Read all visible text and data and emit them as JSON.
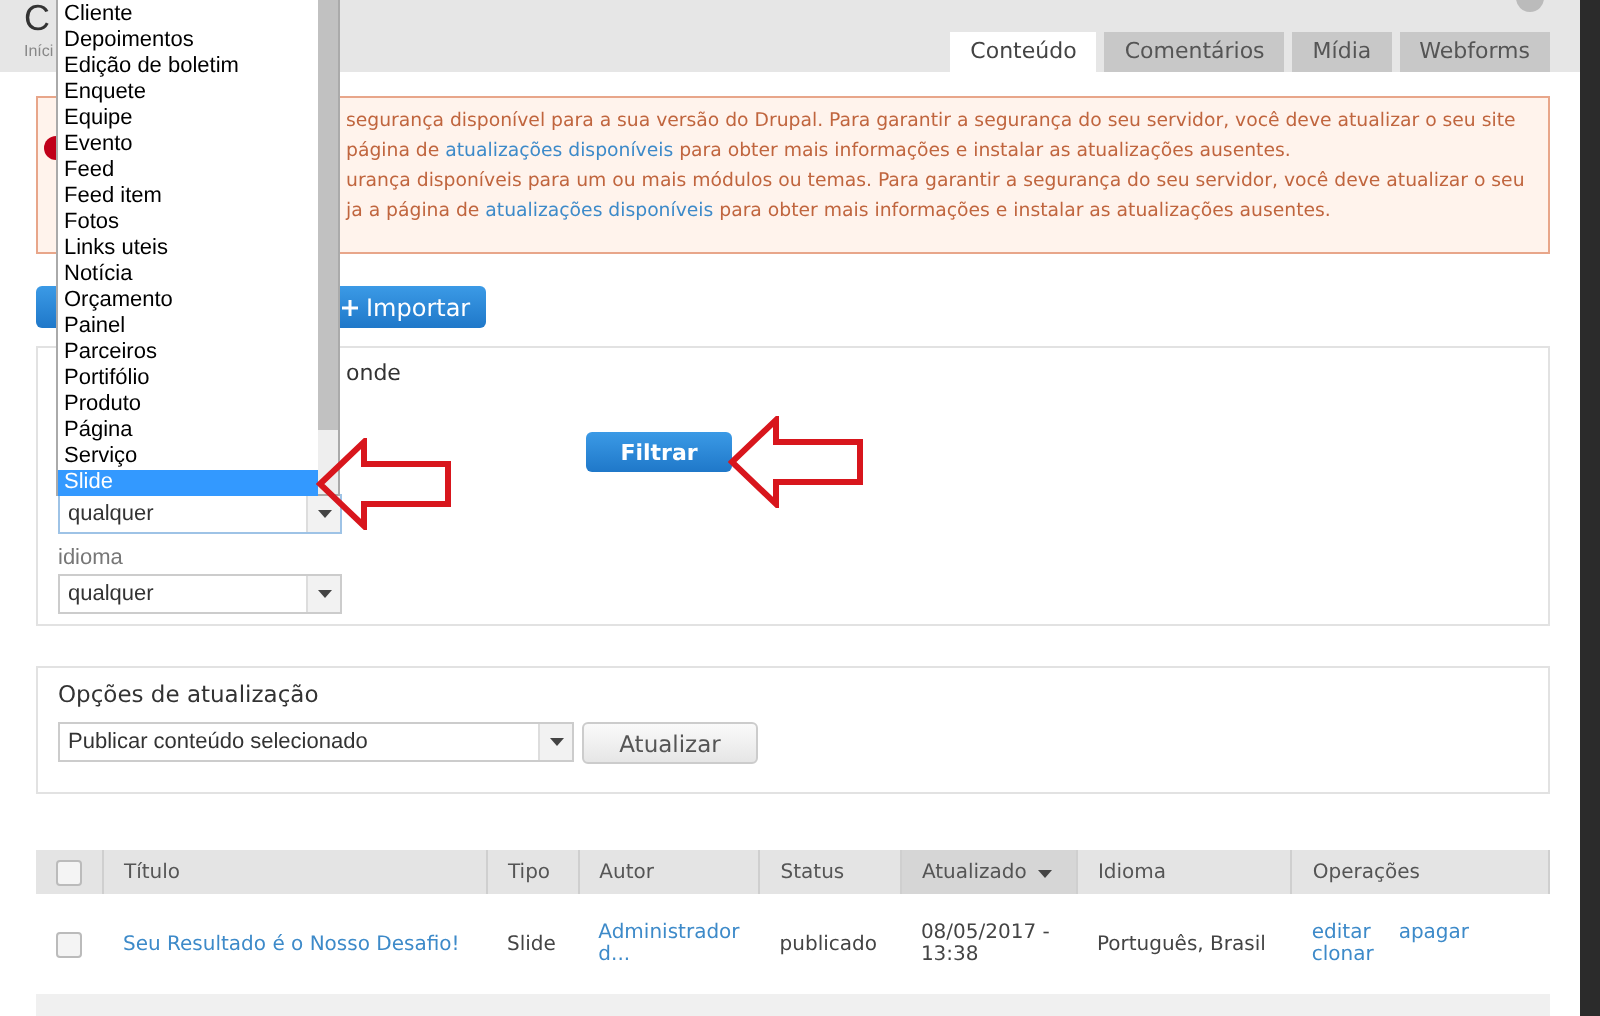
{
  "page": {
    "title": "C",
    "breadcrumb": "Iníci"
  },
  "tabs": [
    {
      "label": "Conteúdo",
      "selected": true
    },
    {
      "label": "Comentários",
      "selected": false
    },
    {
      "label": "Mídia",
      "selected": false
    },
    {
      "label": "Webforms",
      "selected": false
    }
  ],
  "warning": {
    "lines": [
      {
        "text": "segurança disponível para a sua versão do Drupal. Para garantir a segurança do seu servidor, você deve atualizar o seu site"
      },
      {
        "text": "página de ",
        "link": "atualizações disponíveis",
        "after": " para obter mais informações e instalar as atualizações ausentes."
      },
      {
        "text": "urança disponíveis para um ou mais módulos ou temas. Para garantir a segurança do seu servidor, você deve atualizar o seu"
      },
      {
        "text": "ja a página de ",
        "link": "atualizações disponíveis",
        "after": " para obter mais informações e instalar as atualizações ausentes."
      }
    ]
  },
  "actions": {
    "import_button": "Importar"
  },
  "filter": {
    "legend": "onde",
    "type_select": {
      "value": "qualquer",
      "expanded": true,
      "options": [
        {
          "label": "Cliente",
          "selected": false
        },
        {
          "label": "Depoimentos",
          "selected": false
        },
        {
          "label": "Edição de boletim",
          "selected": false
        },
        {
          "label": "Enquete",
          "selected": false
        },
        {
          "label": "Equipe",
          "selected": false
        },
        {
          "label": "Evento",
          "selected": false
        },
        {
          "label": "Feed",
          "selected": false
        },
        {
          "label": "Feed item",
          "selected": false
        },
        {
          "label": "Fotos",
          "selected": false
        },
        {
          "label": "Links uteis",
          "selected": false
        },
        {
          "label": "Notícia",
          "selected": false
        },
        {
          "label": "Orçamento",
          "selected": false
        },
        {
          "label": "Painel",
          "selected": false
        },
        {
          "label": "Parceiros",
          "selected": false
        },
        {
          "label": "Portifólio",
          "selected": false
        },
        {
          "label": "Produto",
          "selected": false
        },
        {
          "label": "Página",
          "selected": false
        },
        {
          "label": "Serviço",
          "selected": false
        },
        {
          "label": "Slide",
          "selected": true
        }
      ]
    },
    "language": {
      "label": "idioma",
      "value": "qualquer"
    },
    "filter_button": "Filtrar"
  },
  "update": {
    "title": "Opções de atualização",
    "action": "Publicar conteúdo selecionado",
    "button": "Atualizar"
  },
  "table": {
    "select_all_checked": false,
    "columns": [
      {
        "label": "Título",
        "sorted": false
      },
      {
        "label": "Tipo",
        "sorted": false
      },
      {
        "label": "Autor",
        "sorted": false
      },
      {
        "label": "Status",
        "sorted": false
      },
      {
        "label": "Atualizado",
        "sorted": true
      },
      {
        "label": "Idioma",
        "sorted": false
      },
      {
        "label": "Operações",
        "sorted": false
      }
    ],
    "rows": [
      {
        "checked": false,
        "title": "Seu Resultado é o Nosso Desafio!",
        "type": "Slide",
        "author": "Administrador d...",
        "status": "publicado",
        "updated": "08/05/2017 - 13:38",
        "language": "Português, Brasil",
        "operations": [
          "editar",
          "apagar",
          "clonar"
        ]
      }
    ]
  }
}
